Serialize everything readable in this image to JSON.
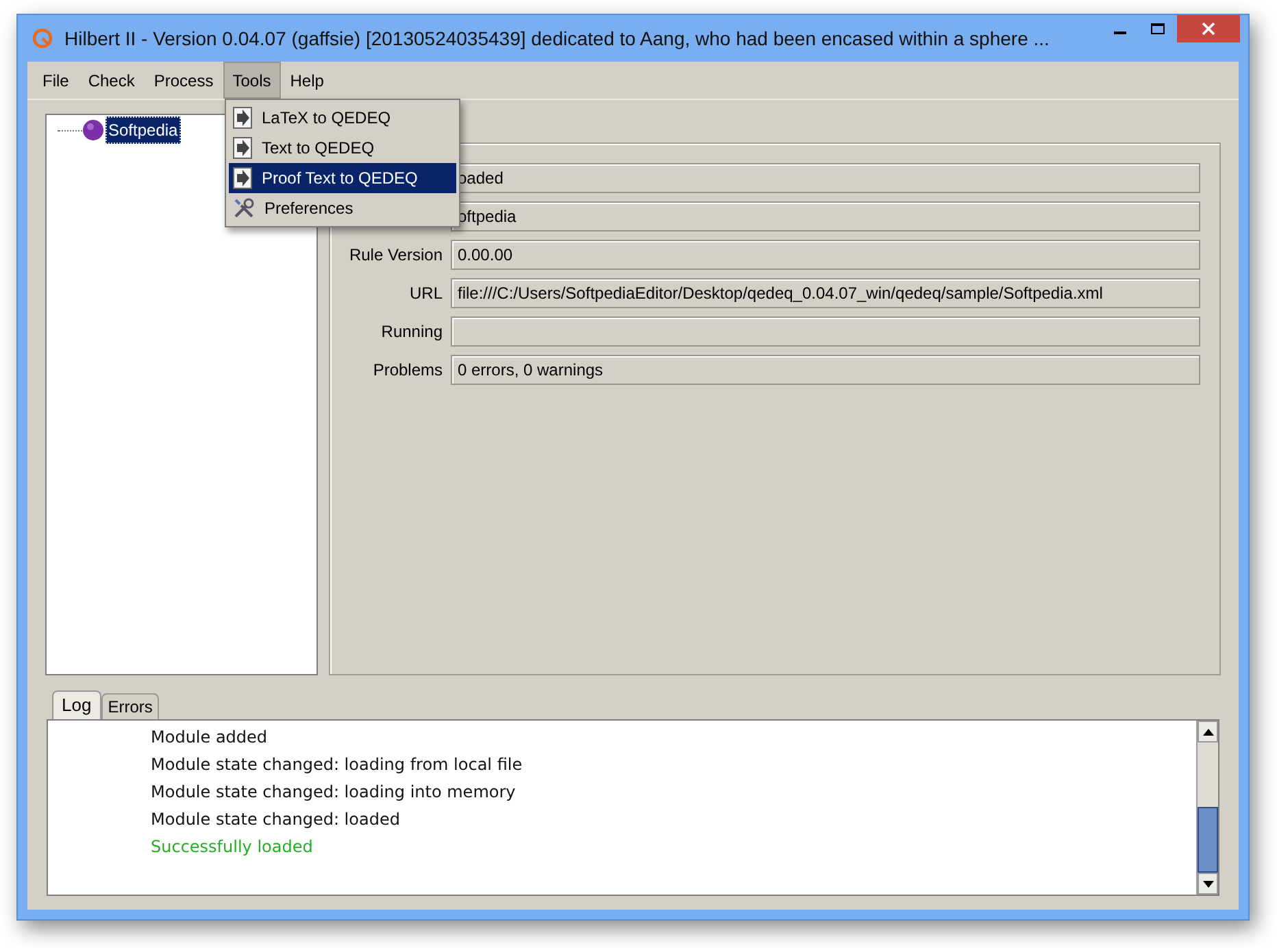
{
  "window": {
    "title": "Hilbert II - Version 0.04.07 (gaffsie) [20130524035439] dedicated to Aang, who had been encased within a sphere ..."
  },
  "menu_bar": [
    {
      "label": "File",
      "selected": false
    },
    {
      "label": "Check",
      "selected": false
    },
    {
      "label": "Process",
      "selected": false
    },
    {
      "label": "Tools",
      "selected": true
    },
    {
      "label": "Help",
      "selected": false
    }
  ],
  "tools_menu": [
    {
      "label": "LaTeX to QEDEQ",
      "kind": "convert",
      "selected": false
    },
    {
      "label": "Text to QEDEQ",
      "kind": "convert",
      "selected": false
    },
    {
      "label": "Proof Text to QEDEQ",
      "kind": "convert",
      "selected": true
    },
    {
      "label": "Preferences",
      "kind": "settings",
      "selected": false
    }
  ],
  "tree": [
    {
      "label": "Softpedia",
      "selected": true
    }
  ],
  "properties": [
    {
      "value": "oaded"
    },
    {
      "value": "oftpedia"
    },
    {
      "label": "Rule Version",
      "value": "0.00.00"
    },
    {
      "label": "URL",
      "value": "file:///C:/Users/SoftpediaEditor/Desktop/qedeq_0.04.07_win/qedeq/sample/Softpedia.xml"
    },
    {
      "label": "Running"
    },
    {
      "label": "Problems",
      "value": "0 errors, 0 warnings"
    }
  ],
  "log_tabs": [
    {
      "label": "Log",
      "selected": true
    },
    {
      "label": "Errors",
      "selected": false
    }
  ],
  "log": [
    {
      "text": "Module added",
      "kind": "info"
    },
    {
      "text": "Module state changed: loading from local file",
      "kind": "info"
    },
    {
      "text": "Module state changed: loading into memory",
      "kind": "info"
    },
    {
      "text": "Module state changed: loaded",
      "kind": "info"
    },
    {
      "text": "Successfully loaded",
      "kind": "success"
    }
  ]
}
